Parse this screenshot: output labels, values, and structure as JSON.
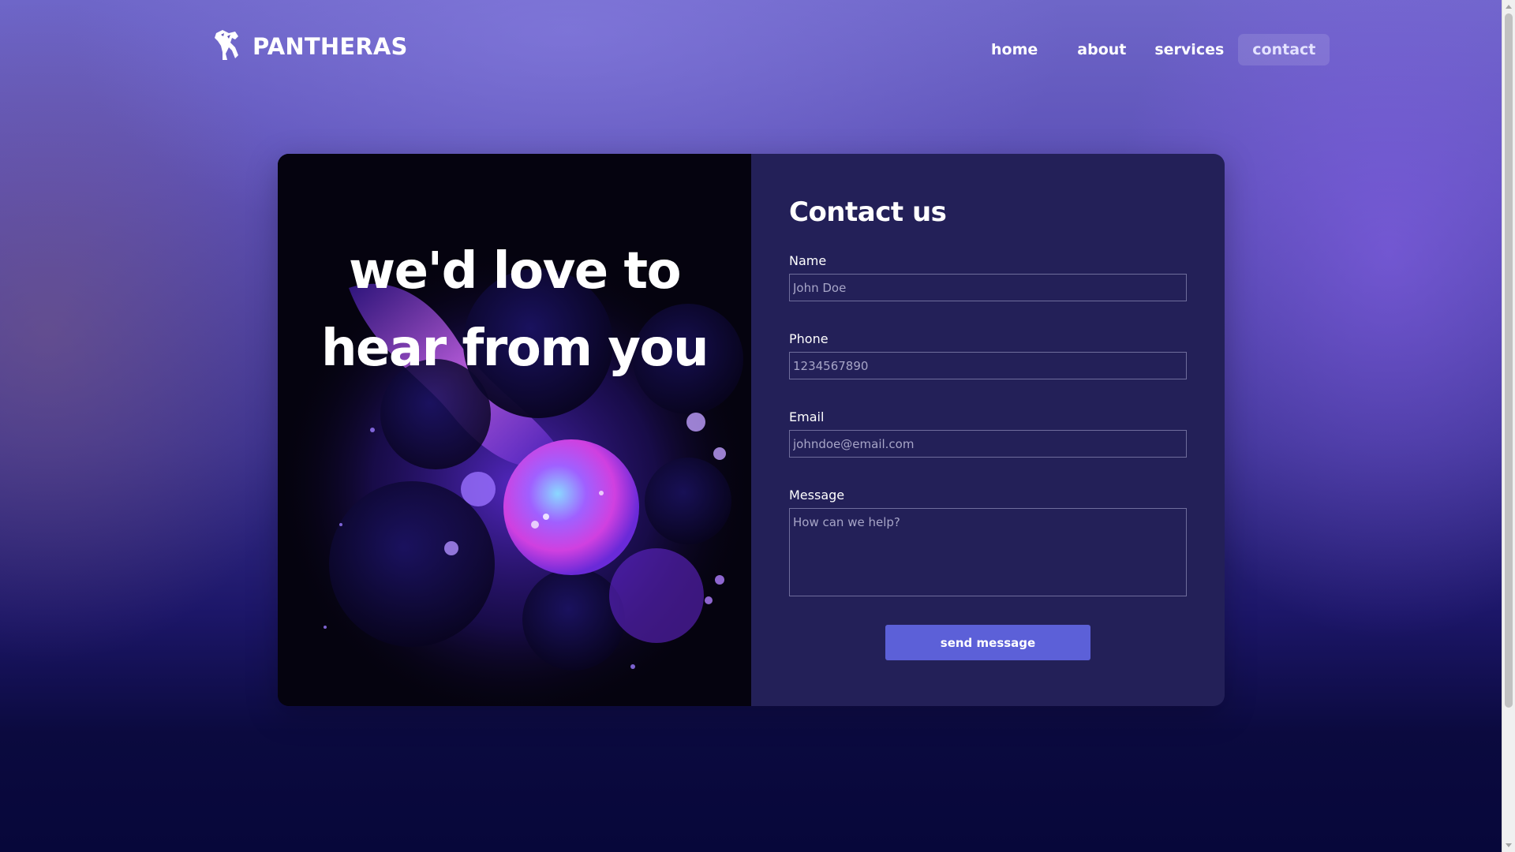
{
  "brand": {
    "name": "PANTHERAS",
    "logo_icon": "panther-head-icon"
  },
  "nav": {
    "items": [
      {
        "label": "home"
      },
      {
        "label": "about"
      },
      {
        "label": "services"
      },
      {
        "label": "contact",
        "active": true
      }
    ]
  },
  "hero": {
    "line1": "we'd love to",
    "line2": "hear from you"
  },
  "form": {
    "title": "Contact us",
    "name": {
      "label": "Name",
      "placeholder": "John Doe"
    },
    "phone": {
      "label": "Phone",
      "placeholder": "1234567890"
    },
    "email": {
      "label": "Email",
      "placeholder": "johndoe@email.com"
    },
    "message": {
      "label": "Message",
      "placeholder": "How can we help?"
    },
    "submit_label": "send message"
  },
  "colors": {
    "panel": "#232058",
    "button": "#5c60d8",
    "text": "#ffffff"
  }
}
